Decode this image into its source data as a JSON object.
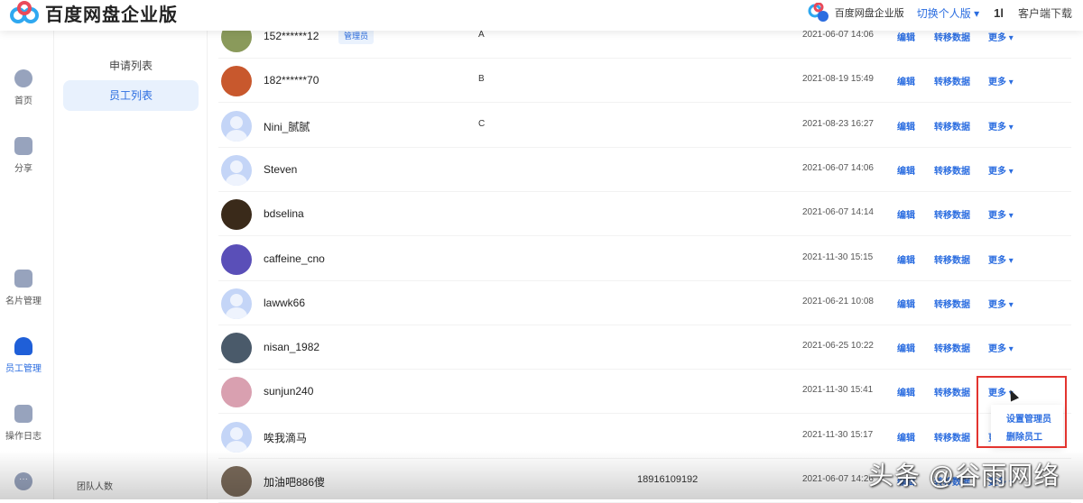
{
  "header": {
    "logo_title": "百度网盘企业版",
    "enterprise_name": "百度网盘企业版",
    "switch_label": "切换个人版",
    "sort_icon": "1l",
    "download_label": "客户端下载"
  },
  "nav": {
    "items": [
      {
        "label": "首页",
        "icon": "cloud-icon"
      },
      {
        "label": "分享",
        "icon": "share-icon"
      },
      {
        "label": "名片管理",
        "icon": "card-icon"
      },
      {
        "label": "员工管理",
        "icon": "people-icon",
        "active": true
      },
      {
        "label": "操作日志",
        "icon": "doc-icon"
      }
    ]
  },
  "subnav": {
    "items": [
      {
        "label": "申请列表"
      },
      {
        "label": "员工列表",
        "active": true
      }
    ],
    "team_label": "团队人数"
  },
  "actions": {
    "edit": "编辑",
    "transfer": "转移数据",
    "more": "更多"
  },
  "employees": [
    {
      "name": "152******12",
      "badge": "管理员",
      "group": "A",
      "phone": "",
      "date": "2021-06-07 14:06",
      "avatar": "#8a9a5b"
    },
    {
      "name": "182******70",
      "group": "B",
      "phone": "",
      "date": "2021-08-19 15:49",
      "avatar": "#c8582d"
    },
    {
      "name": "Nini_腻腻",
      "group": "C",
      "phone": "",
      "date": "2021-08-23 16:27",
      "avatar": ""
    },
    {
      "name": "Steven",
      "group": "",
      "phone": "",
      "date": "2021-06-07 14:06",
      "avatar": ""
    },
    {
      "name": "bdselina",
      "group": "",
      "phone": "",
      "date": "2021-06-07 14:14",
      "avatar": "#3a2a1a"
    },
    {
      "name": "caffeine_cno",
      "group": "",
      "phone": "",
      "date": "2021-11-30 15:15",
      "avatar": "#5a4fb8"
    },
    {
      "name": "lawwk66",
      "group": "",
      "phone": "",
      "date": "2021-06-21 10:08",
      "avatar": ""
    },
    {
      "name": "nisan_1982",
      "group": "",
      "phone": "",
      "date": "2021-06-25 10:22",
      "avatar": "#4a5a6a"
    },
    {
      "name": "sunjun240",
      "group": "",
      "phone": "",
      "date": "2021-11-30 15:41",
      "avatar": "#d9a0b0"
    },
    {
      "name": "唉我滴马",
      "group": "",
      "phone": "",
      "date": "2021-11-30 15:17",
      "avatar": ""
    },
    {
      "name": "加油吧886傻",
      "group": "",
      "phone": "18916109192",
      "date": "2021-06-07 14:26",
      "avatar": "#7a6a5a"
    }
  ],
  "dropdown": {
    "items": [
      "设置管理员",
      "删除员工"
    ]
  },
  "watermark": "头条 @谷雨网络"
}
